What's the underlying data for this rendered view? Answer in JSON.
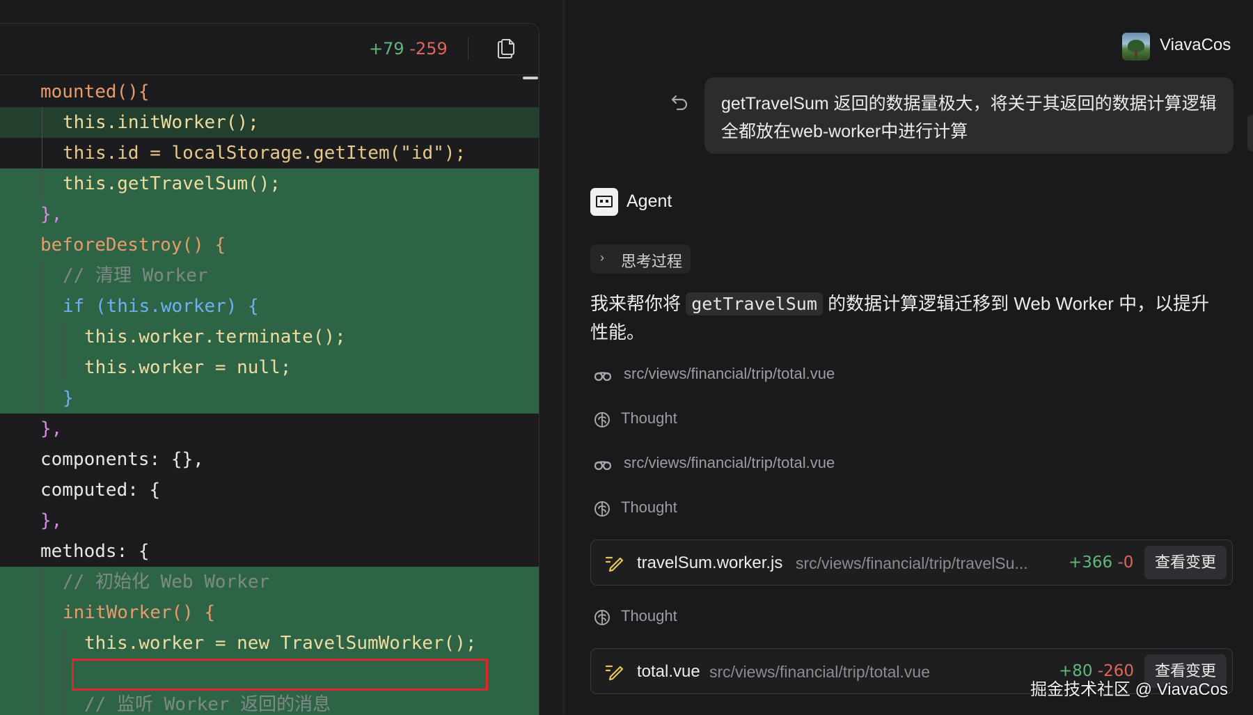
{
  "editor": {
    "diff_added": "+79",
    "diff_removed": "-259",
    "copy_icon": "copy-icon",
    "lines": [
      "mounted(){",
      "this.initWorker();",
      "this.id = localStorage.getItem(\"id\");",
      "this.getTravelSum();",
      "},",
      "beforeDestroy() {",
      "// 清理 Worker",
      "if (this.worker) {",
      "this.worker.terminate();",
      "this.worker = null;",
      "}",
      "},",
      "components: {},",
      "computed: {",
      "},",
      "methods: {",
      "// 初始化 Web Worker",
      "initWorker() {",
      "this.worker = new TravelSumWorker();",
      "",
      "// 监听 Worker 返回的消息"
    ]
  },
  "user": {
    "name": "ViavaCos",
    "message": "getTravelSum 返回的数据量极大，将关于其返回的数据计算逻辑全都放在web-worker中进行计算"
  },
  "agent": {
    "label": "Agent",
    "thinking_toggle": "思考过程",
    "message_prefix": "我来帮你将",
    "message_code": "getTravelSum",
    "message_suffix": "的数据计算逻辑迁移到 Web Worker 中，以提升性能。",
    "steps": [
      {
        "type": "read",
        "icon": "glasses-icon",
        "text": "src/views/financial/trip/total.vue"
      },
      {
        "type": "thought",
        "icon": "brain-icon",
        "text": "Thought"
      },
      {
        "type": "read",
        "icon": "glasses-icon",
        "text": "src/views/financial/trip/total.vue"
      },
      {
        "type": "thought",
        "icon": "brain-icon",
        "text": "Thought"
      },
      {
        "type": "thought",
        "icon": "brain-icon",
        "text": "Thought"
      }
    ],
    "files": [
      {
        "name": "travelSum.worker.js",
        "path": "src/views/financial/trip/travelSu...",
        "added": "+366",
        "removed": "-0",
        "button": "查看变更"
      },
      {
        "name": "total.vue",
        "path": "src/views/financial/trip/total.vue",
        "added": "+80",
        "removed": "-260",
        "button": "查看变更"
      }
    ]
  },
  "watermark": "掘金技术社区 @ ViavaCos",
  "colors": {
    "background": "#1a1a1c",
    "diff_add_bg": "#2e6446",
    "diff_added_text": "#5fb878",
    "diff_removed_text": "#e0665c",
    "highlight_box": "#e3252d"
  }
}
